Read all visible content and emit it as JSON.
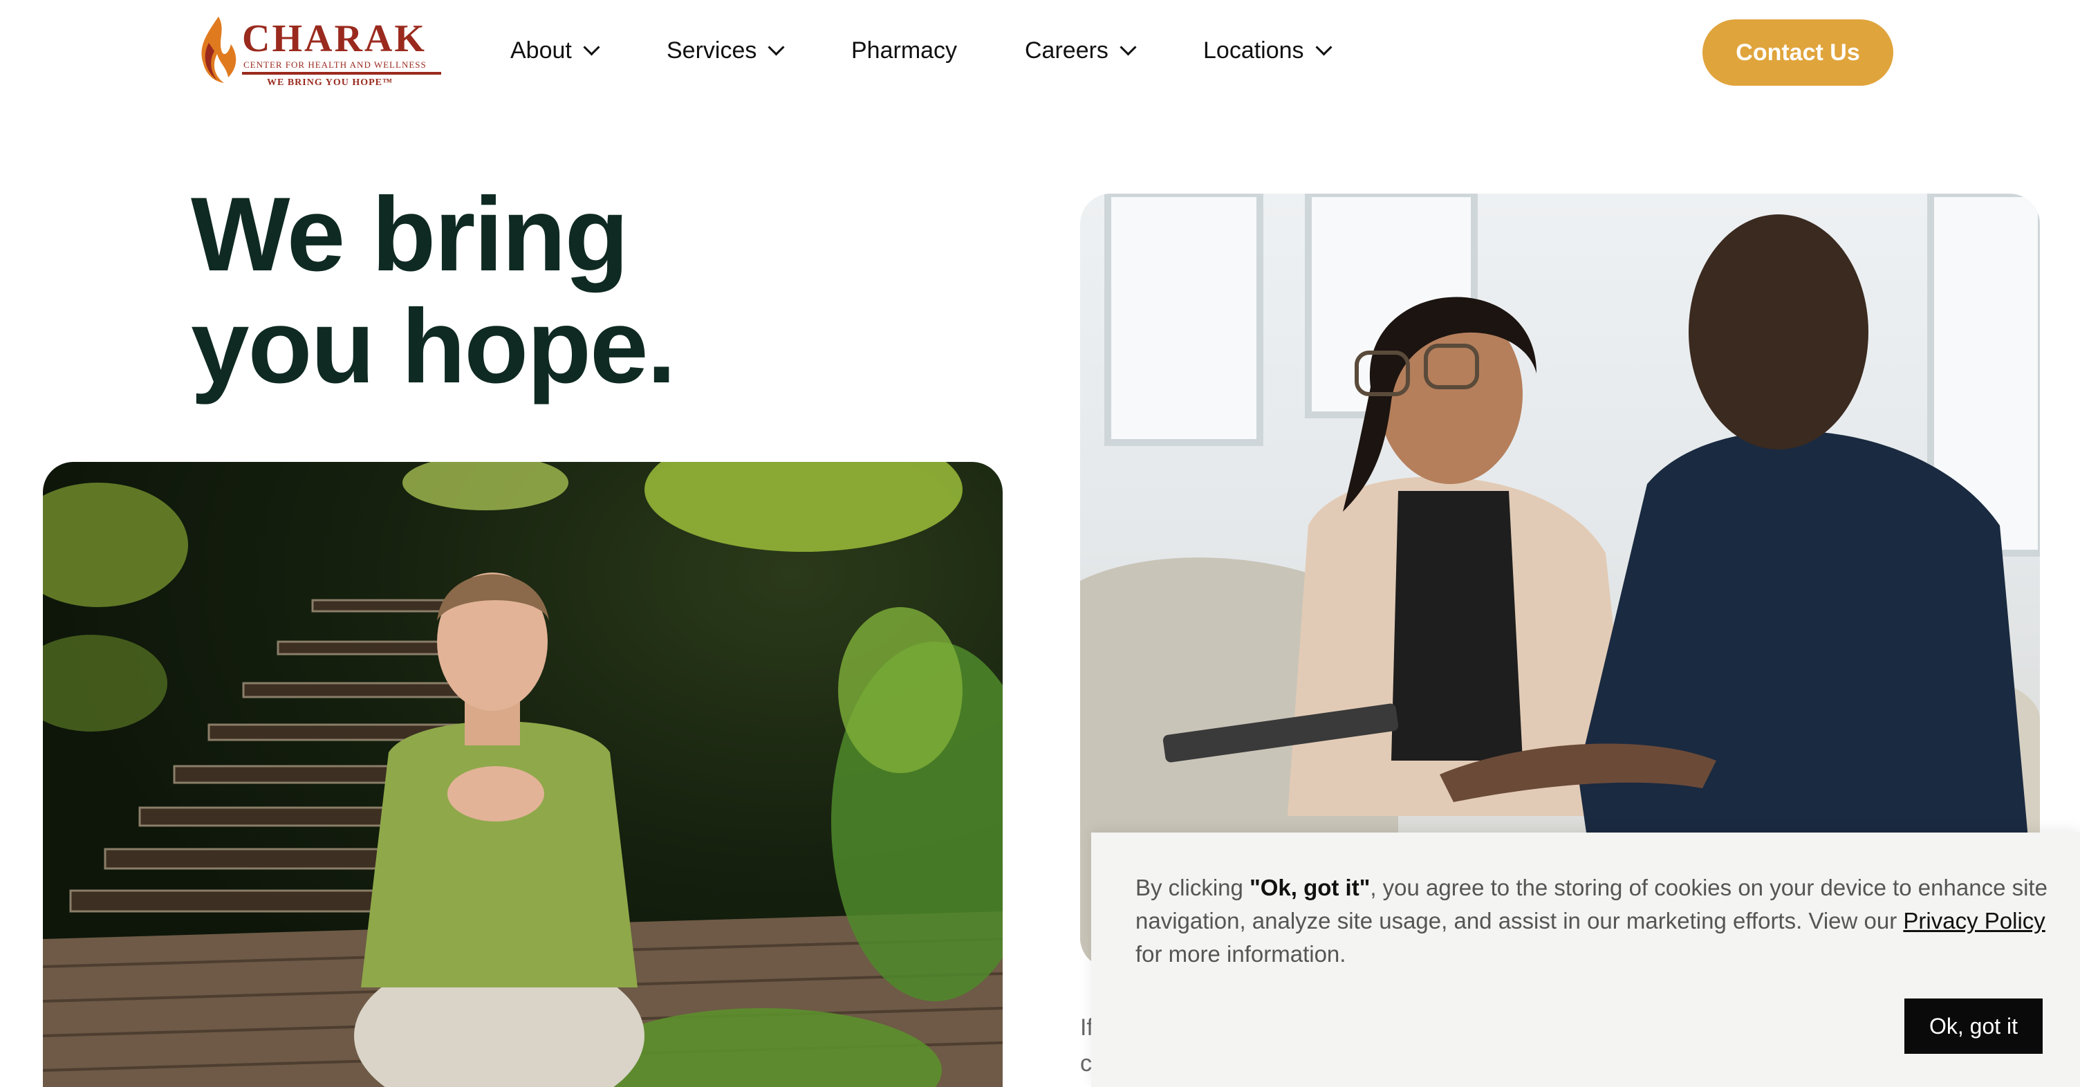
{
  "header": {
    "logo": {
      "name": "CHARAK",
      "subtitle": "CENTER FOR HEALTH AND WELLNESS",
      "tagline": "WE BRING YOU HOPE™",
      "brand_color": "#9a2a1e",
      "flame_colors": [
        "#e07a1f",
        "#9a2a1e"
      ]
    },
    "nav": [
      {
        "label": "About",
        "has_dropdown": true
      },
      {
        "label": "Services",
        "has_dropdown": true
      },
      {
        "label": "Pharmacy",
        "has_dropdown": false
      },
      {
        "label": "Careers",
        "has_dropdown": true
      },
      {
        "label": "Locations",
        "has_dropdown": true
      }
    ],
    "contact_button": "Contact Us",
    "accent_color": "#e0a43c"
  },
  "hero": {
    "title_line1": "We bring",
    "title_line2": "you hope."
  },
  "partial_text": {
    "line1": "If",
    "line2": "c"
  },
  "cookie_banner": {
    "text_before": "By clicking ",
    "bold": "\"Ok, got it\"",
    "text_after": ", you agree to the storing of cookies on your device to enhance site navigation, analyze site usage, and assist in our marketing efforts. View our ",
    "link": "Privacy Policy",
    "text_end": " for more information.",
    "button": "Ok, got it"
  }
}
